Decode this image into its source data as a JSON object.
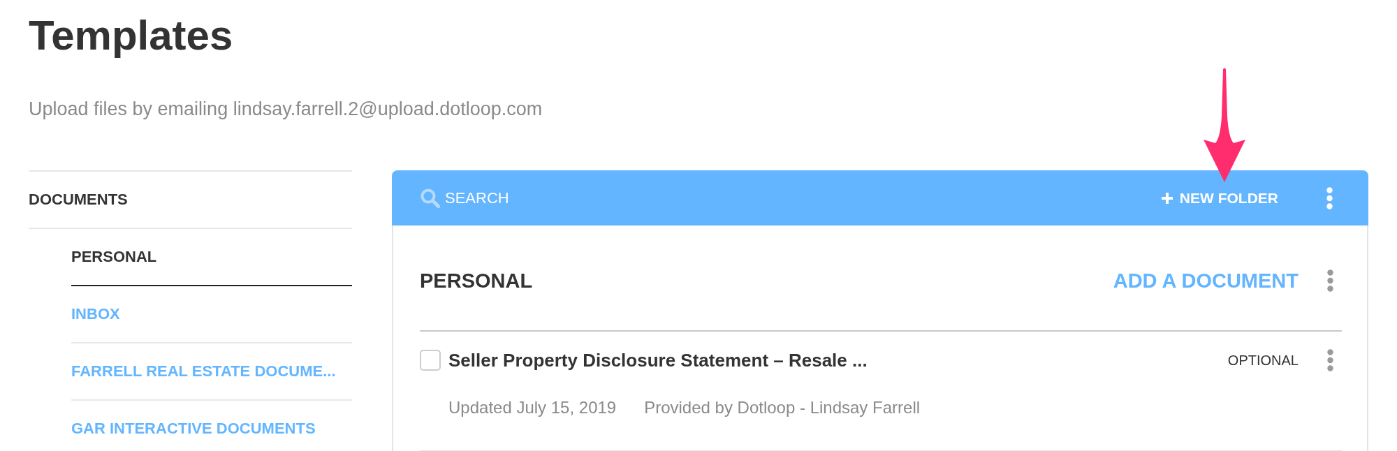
{
  "page": {
    "title": "Templates",
    "subtitle": "Upload files by emailing lindsay.farrell.2@upload.dotloop.com"
  },
  "sidebar": {
    "heading": "DOCUMENTS",
    "items": [
      {
        "label": "PERSONAL",
        "selected": true
      },
      {
        "label": "INBOX",
        "selected": false
      },
      {
        "label": "FARRELL REAL ESTATE DOCUME...",
        "selected": false
      },
      {
        "label": "GAR INTERACTIVE DOCUMENTS",
        "selected": false
      }
    ]
  },
  "toolbar": {
    "search": {
      "placeholder": "SEARCH"
    },
    "new_folder_button": "NEW FOLDER"
  },
  "folder": {
    "title": "PERSONAL",
    "add_button": "ADD A DOCUMENT",
    "documents": [
      {
        "checked": false,
        "title": "Seller Property Disclosure Statement – Resale ...",
        "badge": "OPTIONAL",
        "updated": "Updated July 15, 2019",
        "provider": "Provided by Dotloop - Lindsay Farrell"
      }
    ]
  },
  "annotations": [
    {
      "kind": "arrow"
    }
  ]
}
